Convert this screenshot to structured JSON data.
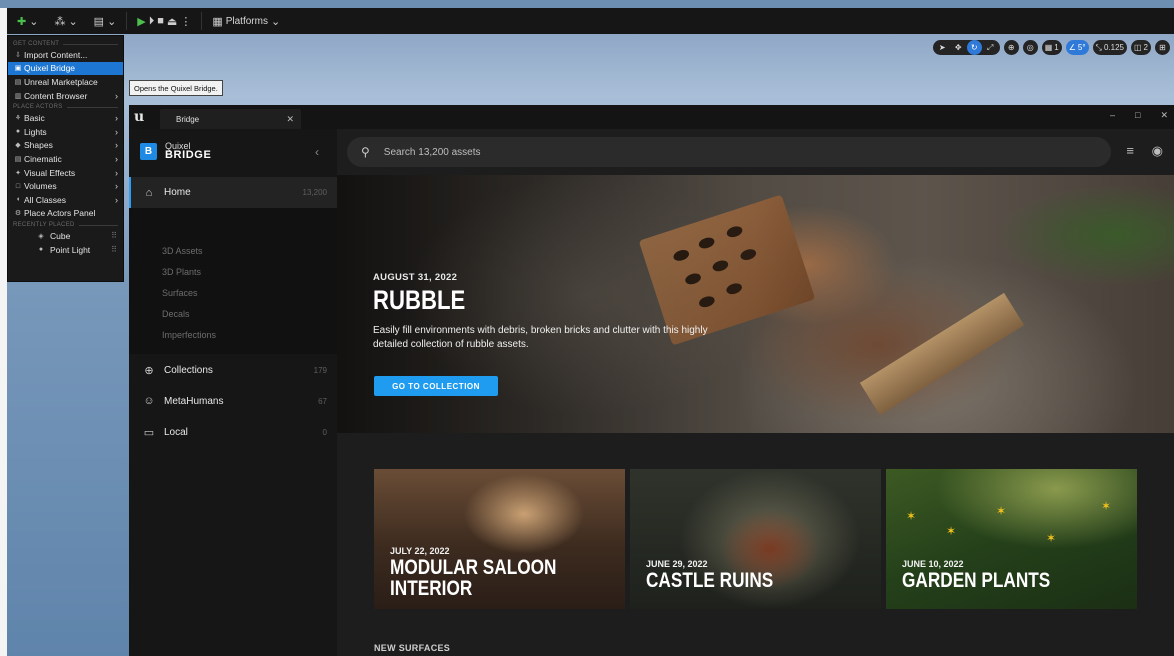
{
  "toolbar": {
    "platforms_label": "Platforms"
  },
  "add_menu": {
    "sec_get_content": "GET CONTENT",
    "import": "Import Content...",
    "quixel": "Quixel Bridge",
    "marketplace": "Unreal Marketplace",
    "content_browser": "Content Browser",
    "sec_place_actors": "PLACE ACTORS",
    "basic": "Basic",
    "lights": "Lights",
    "shapes": "Shapes",
    "cinematic": "Cinematic",
    "visual_effects": "Visual Effects",
    "volumes": "Volumes",
    "all_classes": "All Classes",
    "place_actors_panel": "Place Actors Panel",
    "sec_recently_placed": "RECENTLY PLACED",
    "cube": "Cube",
    "point_light": "Point Light"
  },
  "tooltip": "Opens the Quixel Bridge.",
  "viewport_tools": {
    "grid_value": "1",
    "angle_value": "5°",
    "scale_value": "0.125",
    "camera_value": "2"
  },
  "bridge": {
    "tab_title": "Bridge",
    "brand_line1": "Quixel",
    "brand_line2": "BRIDGE",
    "nav": {
      "home": "Home",
      "home_count": "13,200",
      "assets_3d": "3D Assets",
      "plants_3d": "3D Plants",
      "surfaces": "Surfaces",
      "decals": "Decals",
      "imperfections": "Imperfections",
      "collections": "Collections",
      "collections_count": "179",
      "metahumans": "MetaHumans",
      "metahumans_count": "67",
      "local": "Local",
      "local_count": "0"
    },
    "search_placeholder": "Search 13,200 assets",
    "hero": {
      "date": "AUGUST 31, 2022",
      "title": "RUBBLE",
      "description": "Easily fill environments with debris, broken bricks and clutter with this highly detailed collection of rubble assets.",
      "cta": "GO TO COLLECTION"
    },
    "cards": [
      {
        "date": "JULY 22, 2022",
        "title_line1": "MODULAR SALOON",
        "title_line2": "INTERIOR"
      },
      {
        "date": "JUNE 29, 2022",
        "title_line1": "CASTLE RUINS"
      },
      {
        "date": "JUNE 10, 2022",
        "title_line1": "GARDEN PLANTS"
      }
    ],
    "section_new_surfaces": "NEW SURFACES"
  },
  "colors": {
    "accent": "#1f9cf0",
    "menu_highlight": "#1d76d2"
  }
}
